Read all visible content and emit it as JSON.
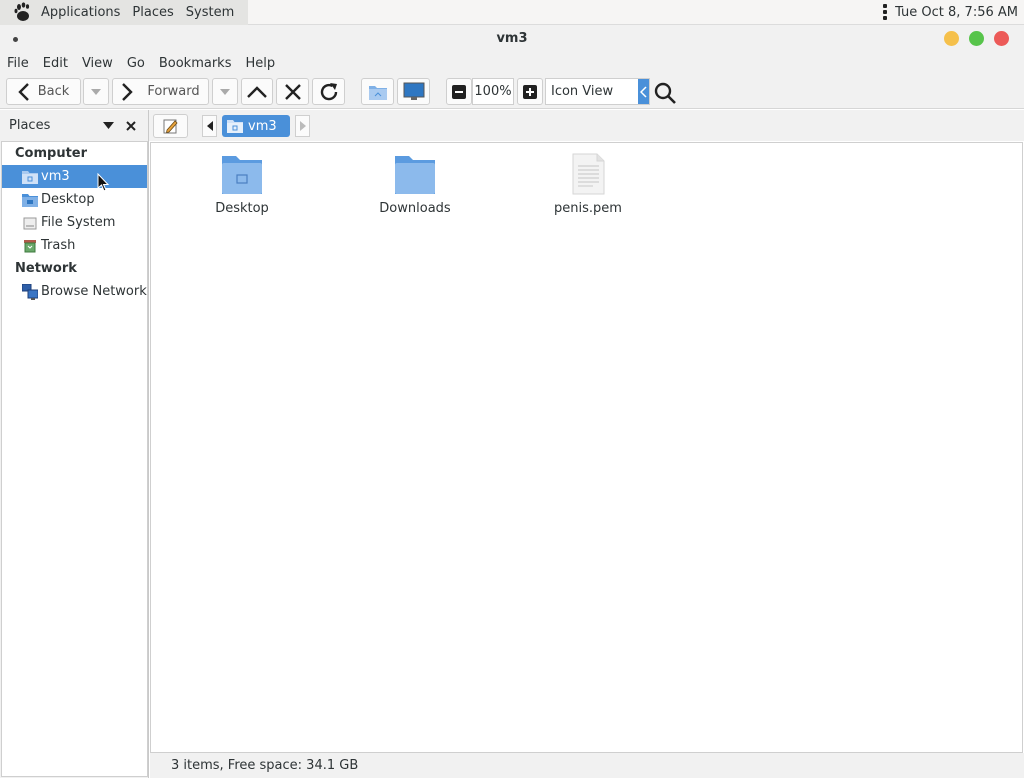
{
  "panel": {
    "menus": [
      "Applications",
      "Places",
      "System"
    ],
    "clock": "Tue Oct  8,  7:56 AM"
  },
  "window": {
    "title": "vm3"
  },
  "menubar": [
    "File",
    "Edit",
    "View",
    "Go",
    "Bookmarks",
    "Help"
  ],
  "toolbar": {
    "back_label": "Back",
    "forward_label": "Forward",
    "zoom_level": "100%",
    "view_mode": "Icon View"
  },
  "sidebar": {
    "title": "Places",
    "sections": [
      {
        "label": "Computer",
        "items": [
          {
            "label": "vm3",
            "icon": "home-folder-icon",
            "selected": true
          },
          {
            "label": "Desktop",
            "icon": "desktop-folder-icon",
            "selected": false
          },
          {
            "label": "File System",
            "icon": "drive-icon",
            "selected": false
          },
          {
            "label": "Trash",
            "icon": "trash-icon",
            "selected": false
          }
        ]
      },
      {
        "label": "Network",
        "items": [
          {
            "label": "Browse Network",
            "icon": "network-icon",
            "selected": false
          }
        ]
      }
    ]
  },
  "pathbar": {
    "current": "vm3"
  },
  "files": [
    {
      "name": "Desktop",
      "icon": "desktop-folder-icon"
    },
    {
      "name": "Downloads",
      "icon": "folder-icon"
    },
    {
      "name": "penis.pem",
      "icon": "text-file-icon"
    }
  ],
  "status": "3 items, Free space: 34.1 GB",
  "colors": {
    "accent": "#4a90d9",
    "folder": "#7fb0e6",
    "minimize": "#f5c04b",
    "maximize": "#57c44b",
    "close": "#ec5a58"
  }
}
